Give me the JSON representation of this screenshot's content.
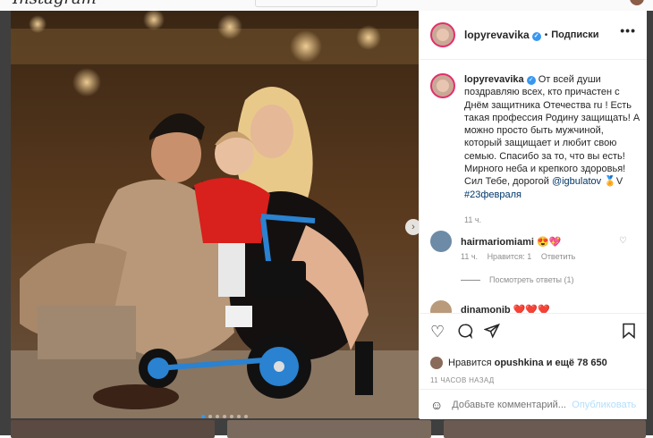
{
  "header": {
    "logo": "Instagram"
  },
  "post": {
    "username": "lopyrevavika",
    "separator": "•",
    "follow_label": "Подписки",
    "more_label": "•••",
    "caption": {
      "username": "lopyrevavika",
      "text": "От всей души поздравляю всех, кто причастен с Днём защитника Отечества ru ! Есть такая профессия Родину защищать! А можно просто быть мужчиной, который защищает и любит свою семью. Спасибо за то, что вы есть! Мирного неба и крепкого здоровья! Сил Тебе, дорогой",
      "mention": "@igbulatov",
      "after_mention": "🏅V",
      "hashtag": "#23февраля",
      "time": "11 ч."
    },
    "comments": [
      {
        "username": "hairmariomiami",
        "text": "😍💖",
        "time": "11 ч.",
        "likes": "Нравится: 1",
        "reply": "Ответить",
        "view_replies": "Посмотреть ответы (1)"
      },
      {
        "username": "dinamonib",
        "text": "❤️❤️❤️"
      }
    ],
    "likes": {
      "prefix": "Нравится",
      "user": "opushkina",
      "suffix": "и ещё 78 650"
    },
    "ago": "11 ЧАСОВ НАЗАД",
    "add_comment_placeholder": "Добавьте комментарий...",
    "publish_label": "Опубликовать"
  },
  "carousel": {
    "slides": 7,
    "active": 0
  },
  "colors": {
    "accent": "#3897f0",
    "verified": "#3897f0",
    "publish_disabled": "#b2dffc"
  }
}
